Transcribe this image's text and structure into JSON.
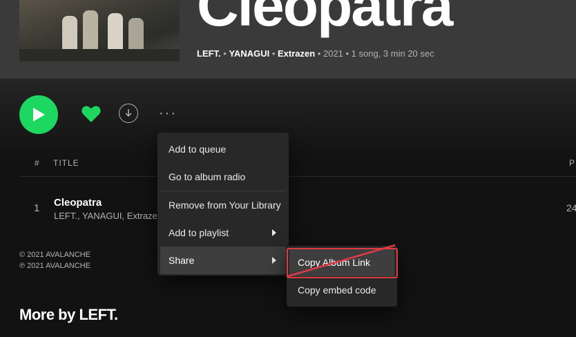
{
  "album": {
    "title": "Cleopatra",
    "artists": [
      "LEFT.",
      "YANAGUI",
      "Extrazen"
    ],
    "separator": " • ",
    "details": " • 2021 • 1 song, 3 min 20 sec"
  },
  "controls": {
    "play_icon": "play-icon",
    "like_icon": "heart-icon",
    "download_icon": "download-icon",
    "more_label": "···",
    "accent_color": "#1ed760"
  },
  "tracklist": {
    "headers": {
      "number": "#",
      "title": "TITLE",
      "right_partial": "P"
    },
    "rows": [
      {
        "number": "1",
        "title": "Cleopatra",
        "artists": "LEFT., YANAGUI, Extrazen",
        "duration_partial": "24"
      }
    ]
  },
  "copyright": {
    "line1": "© 2021 AVALANCHE",
    "line2": "℗ 2021 AVALANCHE"
  },
  "more_by": "More by LEFT.",
  "context_menu": {
    "items": [
      {
        "label": "Add to queue"
      },
      {
        "label": "Go to album radio"
      },
      {
        "label": "Remove from Your Library"
      },
      {
        "label": "Add to playlist"
      },
      {
        "label": "Share"
      }
    ]
  },
  "share_submenu": {
    "items": [
      {
        "label": "Copy Album Link"
      },
      {
        "label": "Copy embed code"
      }
    ]
  },
  "annotation_color": "#e03a45"
}
